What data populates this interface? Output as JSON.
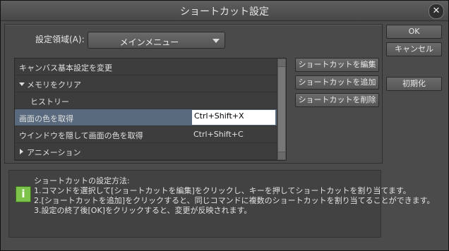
{
  "window": {
    "title": "ショートカット設定"
  },
  "settings_area": {
    "label": "設定領域(A):",
    "selected": "メインメニュー"
  },
  "list": {
    "rows": [
      {
        "label": "キャンバス基本設定を変更",
        "shortcut": ""
      },
      {
        "label": "メモリをクリア",
        "shortcut": "",
        "expanded": true
      },
      {
        "label": "ヒストリー",
        "shortcut": ""
      },
      {
        "label": "画面の色を取得",
        "shortcut": "Ctrl+Shift+X",
        "selected": true
      },
      {
        "label": "ウインドウを隠して画面の色を取得",
        "shortcut": "Ctrl+Shift+C"
      },
      {
        "label": "アニメーション",
        "shortcut": "",
        "collapsed": true
      }
    ]
  },
  "side_buttons": {
    "edit": "ショートカットを編集",
    "add": "ショートカットを追加",
    "delete": "ショートカットを削除"
  },
  "dialog_buttons": {
    "ok": "OK",
    "cancel": "キャンセル",
    "reset": "初期化"
  },
  "info": {
    "icon": "info-icon",
    "heading": "ショートカットの設定方法:",
    "lines": [
      "1.コマンドを選択して[ショートカットを編集]をクリックし、キーを押してショートカットを割り当てます。",
      "2.[ショートカットを追加]をクリックすると、同じコマンドに複数のショートカットを割り当てることができます。",
      "3.設定の終了後[OK]をクリックすると、変更が反映されます。"
    ]
  },
  "colors": {
    "selection": "#5a6a7e",
    "info_icon": "#7dc24a"
  }
}
